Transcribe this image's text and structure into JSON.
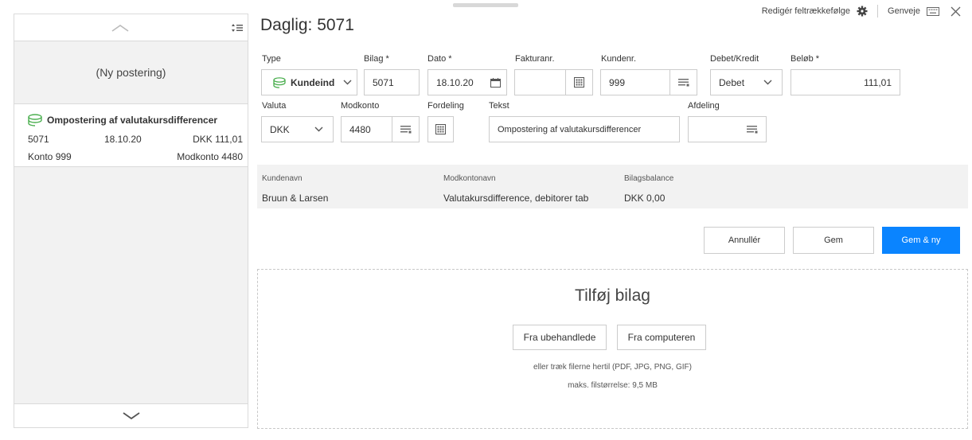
{
  "sidebar": {
    "new_posting": "(Ny postering)",
    "entry": {
      "title": "Ompostering af valutakursdifferencer",
      "number": "5071",
      "date": "18.10.20",
      "amount": "DKK 111,01",
      "account": "Konto 999",
      "contra": "Modkonto 4480"
    }
  },
  "topbar": {
    "edit_order": "Redigér feltrækkefølge",
    "shortcuts": "Genveje"
  },
  "page": {
    "title": "Daglig: 5071"
  },
  "form": {
    "type_label": "Type",
    "type_value": "Kundeind",
    "bilag_label": "Bilag *",
    "bilag_value": "5071",
    "dato_label": "Dato *",
    "dato_value": "18.10.20",
    "faktura_label": "Fakturanr.",
    "faktura_value": "",
    "kundenr_label": "Kundenr.",
    "kundenr_value": "999",
    "debet_label": "Debet/Kredit",
    "debet_value": "Debet",
    "belob_label": "Beløb *",
    "belob_value": "111,01",
    "valuta_label": "Valuta",
    "valuta_value": "DKK",
    "modkonto_label": "Modkonto",
    "modkonto_value": "4480",
    "fordeling_label": "Fordeling",
    "tekst_label": "Tekst",
    "tekst_value": "Ompostering af valutakursdifferencer",
    "afdeling_label": "Afdeling",
    "afdeling_value": ""
  },
  "info": {
    "kundenavn_label": "Kundenavn",
    "kundenavn_value": "Bruun & Larsen",
    "modkontonavn_label": "Modkontonavn",
    "modkontonavn_value": "Valutakursdifference, debitorer tab",
    "balance_label": "Bilagsbalance",
    "balance_value": "DKK 0,00"
  },
  "actions": {
    "cancel": "Annullér",
    "save": "Gem",
    "save_new": "Gem & ny"
  },
  "attach": {
    "title": "Tilføj bilag",
    "from_unprocessed": "Fra ubehandlede",
    "from_computer": "Fra computeren",
    "drag_note": "eller træk filerne hertil (PDF, JPG, PNG, GIF)",
    "max_size": "maks. filstørrelse: 9,5 MB"
  },
  "colors": {
    "accent": "#0a84ff",
    "type_icon": "#4caf50"
  }
}
